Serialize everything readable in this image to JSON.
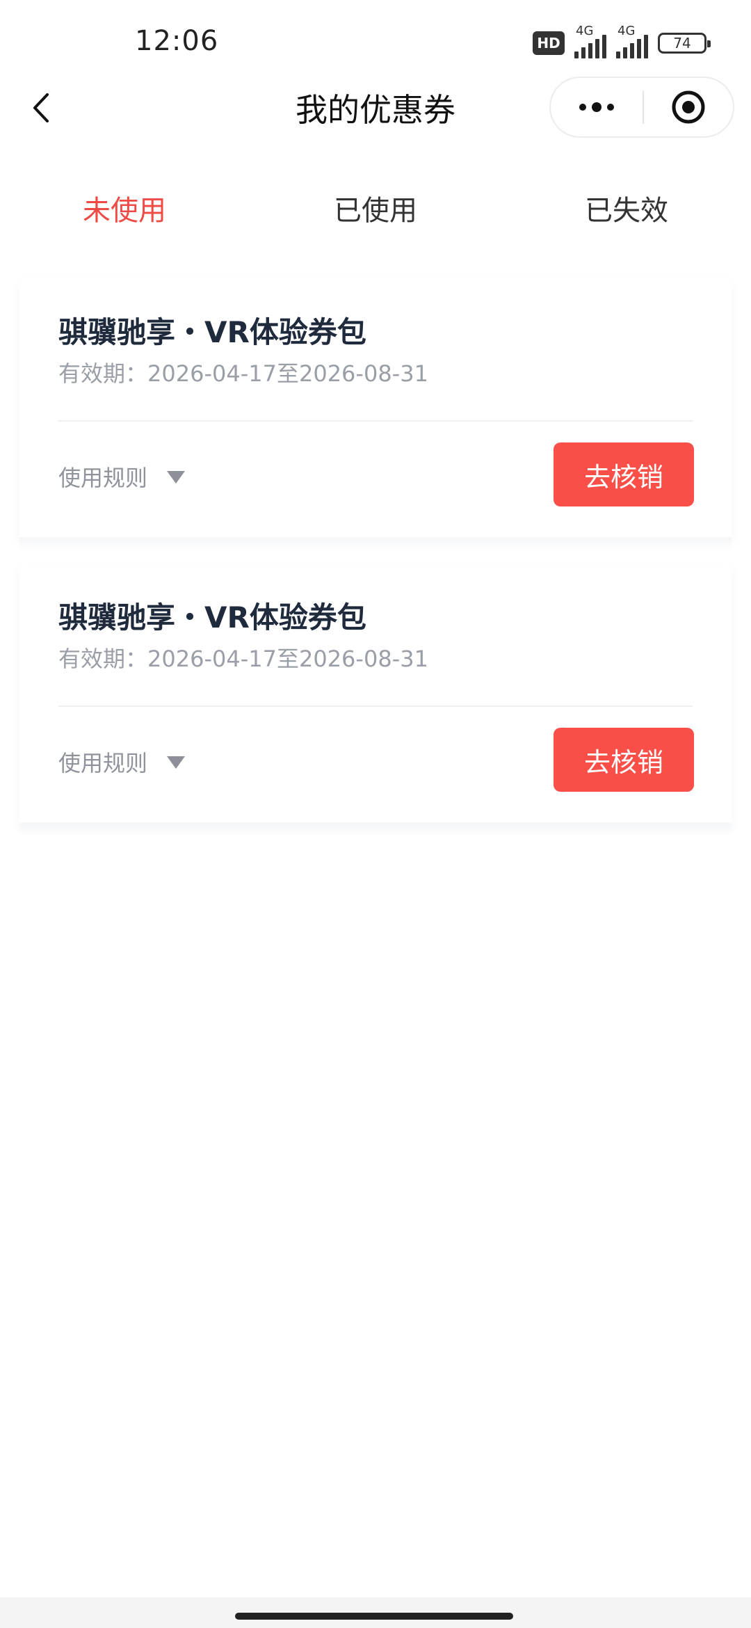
{
  "status_bar": {
    "time": "12:06",
    "hd_badge": "HD",
    "network_1": "4G",
    "network_2": "4G",
    "battery": "74"
  },
  "nav": {
    "title": "我的优惠券",
    "back_icon": "chevron-left-icon",
    "more_icon": "more-dots-icon",
    "close_icon": "target-close-icon"
  },
  "tabs": [
    {
      "label": "未使用",
      "active": true
    },
    {
      "label": "已使用",
      "active": false
    },
    {
      "label": "已失效",
      "active": false
    }
  ],
  "coupons": [
    {
      "title": "骐骥驰享・VR体验券包",
      "validity": "有效期：2026-04-17至2026-08-31",
      "rules_label": "使用规则",
      "button_label": "去核销"
    },
    {
      "title": "骐骥驰享・VR体验券包",
      "validity": "有效期：2026-04-17至2026-08-31",
      "rules_label": "使用规则",
      "button_label": "去核销"
    }
  ],
  "colors": {
    "accent": "#f04a44",
    "button": "#fa4f48",
    "title_text": "#1f2a3d",
    "secondary_text": "#9a9ea6"
  }
}
